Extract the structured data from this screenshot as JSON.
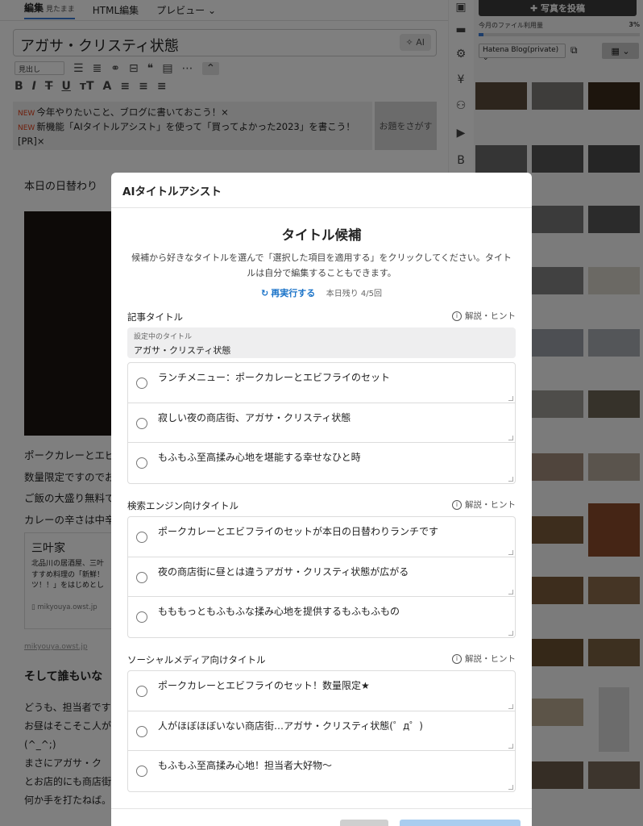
{
  "editor": {
    "tabs": [
      {
        "label": "編集",
        "sub": "見たまま"
      },
      {
        "label": "HTML編集"
      },
      {
        "label": "プレビュー ⌄"
      }
    ],
    "title_value": "アガサ・クリスティ状態",
    "ai_button": "✧ AI",
    "format_select": "見出し",
    "notices": [
      {
        "badge": "NEW",
        "text": "今年やりたいこと、ブログに書いておこう！×"
      },
      {
        "badge": "NEW",
        "text": "新機能「AIタイトルアシスト」を使って「買ってよかった2023」を書こう！[PR]×"
      }
    ],
    "find_topic": "お題をさがす",
    "body_heading": "本日の日替わり",
    "body_lines": [
      "ポークカレーとエビ",
      "数量限定ですのでお",
      "ご飯の大盛り無料で",
      "カレーの辛さは中辛"
    ],
    "card": {
      "title": "三叶家",
      "text": "北品川の居酒屋、三叶 すすめ料理の「新鮮！ ツ！！」をはじめとし",
      "url": "mikyouya.owst.jp"
    },
    "card_link": "mikyouya.owst.jp",
    "heading2": "そして誰もいな",
    "lines2": [
      "どうも、担当者です",
      "お昼はそこそこ人が",
      "(^_^;)",
      "まさにアガサ・ク",
      "とお店的にも商店街",
      "何か手を打たねば。"
    ]
  },
  "photos": {
    "upload_label": "写真を投稿",
    "usage_label": "今月のファイル利用量",
    "usage_pct": "3%",
    "usage_fraction": 0.03,
    "blog_select": "Hatena Blog(private) ⌄"
  },
  "modal": {
    "header": "AIタイトルアシスト",
    "title": "タイトル候補",
    "description": "候補から好きなタイトルを選んで「選択した項目を適用する」をクリックしてください。タイトルは自分で編集することもできます。",
    "retry_label": "再実行する",
    "remaining": "本日残り 4/5回",
    "hint_label": "解説・ヒント",
    "sections": [
      {
        "label": "記事タイトル",
        "current_label": "設定中のタイトル",
        "current_value": "アガサ・クリスティ状態",
        "options": [
          "ランチメニュー：ポークカレーとエビフライのセット",
          "寂しい夜の商店街、アガサ・クリスティ状態",
          "もふもふ至高揉み心地を堪能する幸せなひと時"
        ]
      },
      {
        "label": "検索エンジン向けタイトル",
        "options": [
          "ポークカレーとエビフライのセットが本日の日替わりランチです",
          "夜の商店街に昼とは違うアガサ・クリスティ状態が広がる",
          "もももっともふもふな揉み心地を提供するもふもふもの"
        ]
      },
      {
        "label": "ソーシャルメディア向けタイトル",
        "options": [
          "ポークカレーとエビフライのセット！数量限定★",
          "人がほぼほぼいない商店街…アガサ・クリスティ状態(゜д゜)",
          "もふもふ至高揉み心地！担当者大好物〜"
        ]
      }
    ]
  }
}
